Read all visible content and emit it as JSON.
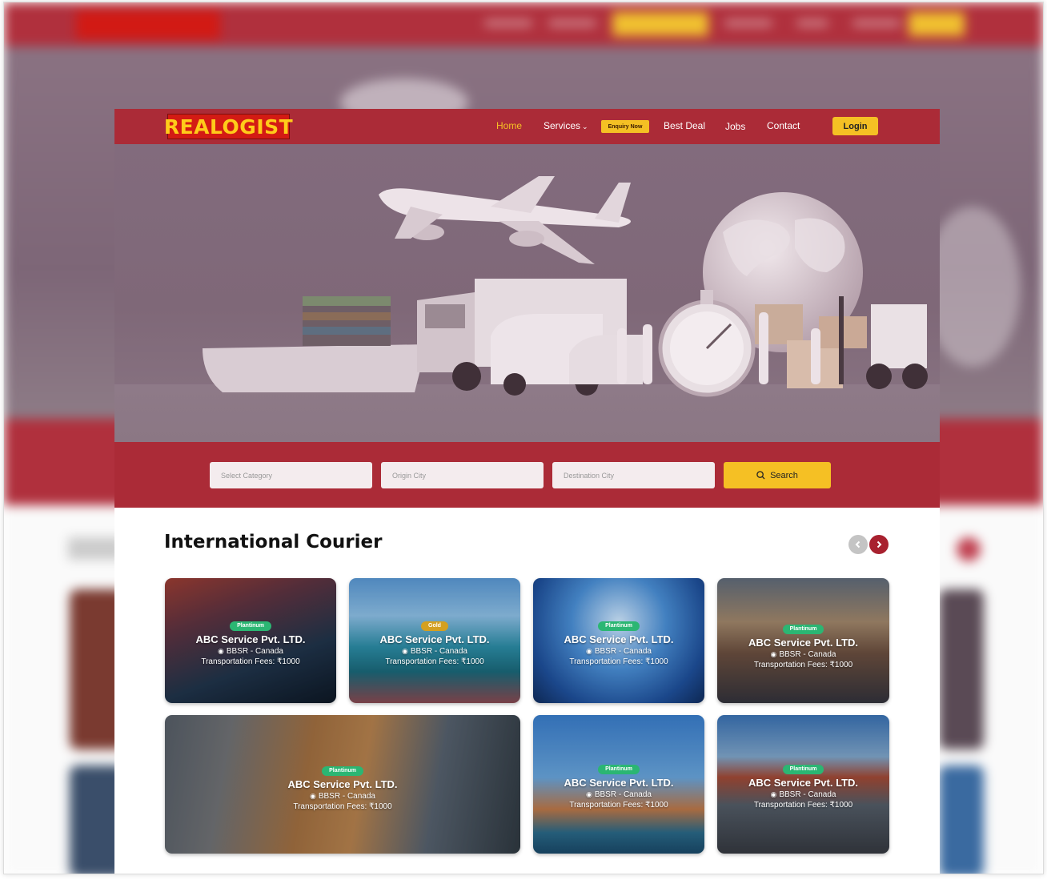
{
  "header": {
    "logo": "REALOGIST",
    "nav": {
      "home": "Home",
      "services": "Services",
      "enquiry": "Enquiry Now",
      "best_deal": "Best Deal",
      "jobs": "Jobs",
      "contact": "Contact",
      "login": "Login"
    }
  },
  "search": {
    "category_placeholder": "Select Category",
    "origin_placeholder": "Origin City",
    "destination_placeholder": "Destination City",
    "button_label": "Search"
  },
  "section": {
    "title": "International Courier"
  },
  "cards": [
    {
      "tier": "Plantinum",
      "name": "ABC Service Pvt. LTD.",
      "route": "BBSR - Canada",
      "fee": "Transportation Fees: ₹1000"
    },
    {
      "tier": "Gold",
      "name": "ABC Service Pvt. LTD.",
      "route": "BBSR - Canada",
      "fee": "Transportation Fees: ₹1000"
    },
    {
      "tier": "Plantinum",
      "name": "ABC Service Pvt. LTD.",
      "route": "BBSR - Canada",
      "fee": "Transportation Fees: ₹1000"
    },
    {
      "tier": "Plantinum",
      "name": "ABC Service Pvt. LTD.",
      "route": "BBSR - Canada",
      "fee": "Transportation Fees: ₹1000"
    },
    {
      "tier": "Plantinum",
      "name": "ABC Service Pvt. LTD.",
      "route": "BBSR - Canada",
      "fee": "Transportation Fees: ₹1000"
    },
    {
      "tier": "Plantinum",
      "name": "ABC Service Pvt. LTD.",
      "route": "BBSR - Canada",
      "fee": "Transportation Fees: ₹1000"
    },
    {
      "tier": "Plantinum",
      "name": "ABC Service Pvt. LTD.",
      "route": "BBSR - Canada",
      "fee": "Transportation Fees: ₹1000"
    }
  ],
  "colors": {
    "brand_red": "#ab2b37",
    "accent_yellow": "#f5c024",
    "logo_red": "#d31b14",
    "tier_green": "#2bb673",
    "tier_gold": "#d4a020"
  }
}
